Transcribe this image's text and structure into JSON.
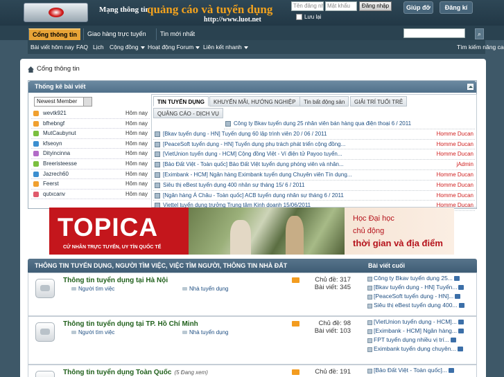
{
  "header": {
    "tagline_small": "Mạng thông tin",
    "tagline_big": "quảng cáo và tuyển dụng",
    "tagline_url": "http://www.luot.net",
    "username_placeholder": "Tên đăng nhập",
    "password_placeholder": "Mật khẩu",
    "login_label": "Đăng nhập",
    "remember_label": "Lưu lại",
    "help_label": "Giúp đỡ",
    "register_label": "Đăng kí"
  },
  "nav": {
    "tabs": [
      "Cổng thông tin",
      "Giao hàng trực tuyến",
      "Tin mới nhất"
    ],
    "sub": [
      "Bài viết hôm nay",
      "FAQ",
      "Lịch",
      "Cộng đồng",
      "Hoạt động Forum",
      "Liên kết nhanh"
    ],
    "advanced_search": "Tìm kiếm nâng cao"
  },
  "breadcrumb": "Cổng thông tin",
  "stats": {
    "title": "Thống kê bài viết",
    "member_filter": "Newest Member",
    "members": [
      {
        "name": "wevtk921",
        "time": "Hôm nay",
        "color": "#f0a030"
      },
      {
        "name": "bfhebngf",
        "time": "Hôm nay",
        "color": "#f0a030"
      },
      {
        "name": "MutCaubynut",
        "time": "Hôm nay",
        "color": "#7bbf3f"
      },
      {
        "name": "kfseoyn",
        "time": "Hôm nay",
        "color": "#3c8fd0"
      },
      {
        "name": "Dityincinna",
        "time": "Hôm nay",
        "color": "#b26bc8"
      },
      {
        "name": "Breeristeesse",
        "time": "Hôm nay",
        "color": "#7bbf3f"
      },
      {
        "name": "Jazrech60",
        "time": "Hôm nay",
        "color": "#3c8fd0"
      },
      {
        "name": "Feerst",
        "time": "Hôm nay",
        "color": "#f0a030"
      },
      {
        "name": "qutxcanv",
        "time": "Hôm nay",
        "color": "#e05a6c"
      }
    ],
    "news_tabs": [
      "TIN TUYỂN DỤNG",
      "KHUYẾN MÃI, HƯỚNG NGHIỆP",
      "Tin bất động sản",
      "GIẢI TRÍ TUỔI TRẺ",
      "QUẢNG CÁO - DỊCH VỤ"
    ],
    "news": [
      {
        "title": "Công ty Bkav tuyển dụng 25 nhân viên bán hàng qua điện thoại 6 / 2011",
        "author": ""
      },
      {
        "title": "[Bkav tuyển dụng - HN] Tuyển dụng 60 lập trình viên 20 / 06 / 2011",
        "author": "Homme Ducan"
      },
      {
        "title": "[PeaceSoft tuyển dụng - HN] Tuyển dụng phụ trách phát triển cộng đồng...",
        "author": "Homme Ducan"
      },
      {
        "title": "[VietUnion tuyển dụng - HCM] Cộng đồng Việt - Ví điện tử Payoo tuyển...",
        "author": "Homme Ducan"
      },
      {
        "title": "[Bảo Đất Việt - Toàn quốc] Bảo Đất Việt tuyển dụng phóng viên và nhân...",
        "author": "jAdmin"
      },
      {
        "title": "[Eximbank - HCM] Ngân hàng Eximbank tuyển dụng Chuyên viên Tín dụng...",
        "author": "Homme Ducan"
      },
      {
        "title": "Siêu thị eBest tuyển dụng 400 nhân sự tháng 15/ 6 / 2011",
        "author": "Homme Ducan"
      },
      {
        "title": "[Ngân hàng Á Châu - Toàn quốc] ACB tuyển dụng nhân sự tháng 6 / 2011",
        "author": "Homme Ducan"
      },
      {
        "title": "Viettel tuyển dụng trưởng Trung tâm Kinh doanh 15/06/2011",
        "author": "Homme Ducan"
      }
    ]
  },
  "banner": {
    "logo": "TOPICA",
    "sub": "CỬ NHÂN TRỰC TUYẾN, UY TÍN QUỐC TẾ",
    "line1": "Học Đại học",
    "line2": "chủ động",
    "line3": "thời gian và địa điểm"
  },
  "forum": {
    "title": "THÔNG TIN TUYỂN DỤNG, NGƯỜI TÌM VIỆC, VIỆC TÌM NGƯỜI, THÔNG TIN NHÀ ĐẤT",
    "latest_label": "Bài viết cuối",
    "rows": [
      {
        "title": "Thông tin tuyển dụng tại Hà Nội",
        "viewing": "",
        "sub1": "Người tìm việc",
        "sub2": "Nhà tuyển dụng",
        "threads": "Chủ đề: 317",
        "posts": "Bài viết: 345",
        "latest": [
          "Công ty Bkav tuyển dụng 25...",
          "[Bkav tuyển dụng - HN] Tuyển...",
          "[PeaceSoft tuyển dụng - HN]...",
          "Siêu thị eBest tuyển dụng 400..."
        ]
      },
      {
        "title": "Thông tin tuyển dụng tại TP. Hồ Chí Minh",
        "viewing": "",
        "sub1": "Người tìm việc",
        "sub2": "Nhà tuyển dụng",
        "threads": "Chủ đề: 98",
        "posts": "Bài viết: 103",
        "latest": [
          "[VietUnion tuyển dụng - HCM]...",
          "[Eximbank - HCM] Ngân hàng...",
          "FPT tuyển dụng nhiều vị trí...",
          "Eximbank tuyển dụng chuyên..."
        ]
      },
      {
        "title": "Thông tin tuyển dụng Toàn Quốc",
        "viewing": "(5 Đang xem)",
        "sub1": "",
        "sub2": "",
        "threads": "Chủ đề: 191",
        "posts": "",
        "latest": [
          "[Bảo Đất Việt - Toàn quốc]..."
        ]
      }
    ]
  }
}
